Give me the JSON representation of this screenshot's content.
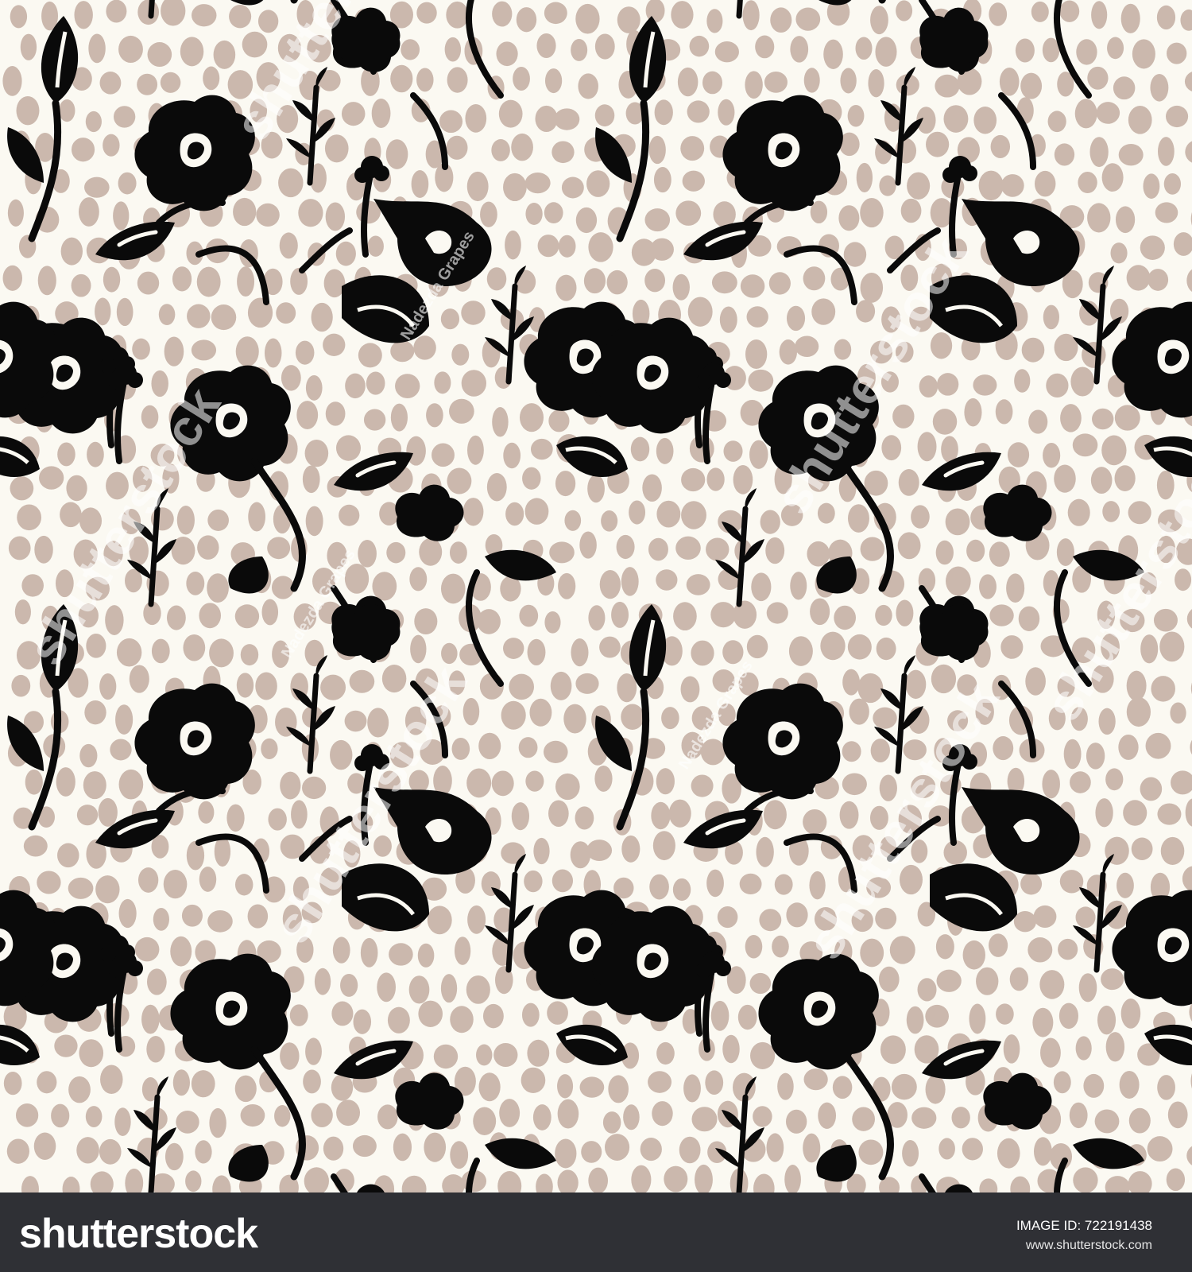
{
  "colors": {
    "background": "#fbf9f2",
    "dots": "#cbb8ad",
    "ink": "#0a0a0a",
    "footer": "#2f3035"
  },
  "watermark": {
    "brand": "shutterstock",
    "author": "Nadezda Grapes"
  },
  "footer": {
    "logo": "shutterstock",
    "image_id": "IMAGE ID: 722191438",
    "url": "www.shutterstock.com"
  }
}
